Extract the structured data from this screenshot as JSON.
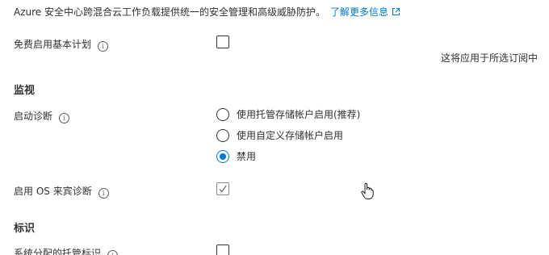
{
  "intro": {
    "text": "Azure 安全中心跨混合云工作负载提供统一的安全管理和高级威胁防护。",
    "link_label": "了解更多信息",
    "link_icon": "external-link-icon"
  },
  "basic_plan": {
    "label": "免费启用基本计划",
    "info_icon": "info-icon",
    "checked": false,
    "note": "这将应用于所选订阅中"
  },
  "monitoring": {
    "heading": "监视",
    "boot_diagnostics": {
      "label": "启动诊断",
      "info_icon": "info-icon",
      "options": [
        {
          "label": "使用托管存储帐户启用(推荐)",
          "selected": false
        },
        {
          "label": "使用自定义存储帐户启用",
          "selected": false
        },
        {
          "label": "禁用",
          "selected": true
        }
      ]
    },
    "os_guest_diagnostics": {
      "label": "启用 OS 来宾诊断",
      "info_icon": "info-icon",
      "checked": true,
      "disabled": true
    }
  },
  "identity": {
    "heading": "标识",
    "system_managed_identity": {
      "label": "系统分配的托管标识",
      "info_icon": "info-icon",
      "checked": false
    }
  },
  "colors": {
    "accent": "#0078d4",
    "text": "#323130",
    "disabled_border": "#8a8886"
  }
}
